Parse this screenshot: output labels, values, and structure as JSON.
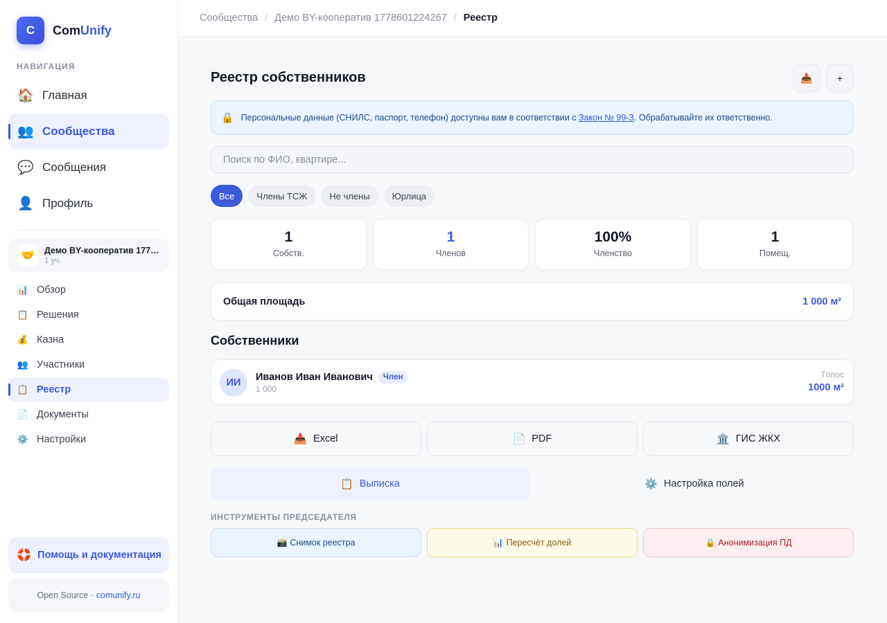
{
  "brand": {
    "badge": "C",
    "name_part1": "Com",
    "name_part2": "Unify"
  },
  "nav": {
    "caption": "НАВИГАЦИЯ",
    "items": [
      {
        "icon": "home-icon",
        "glyph": "🏠",
        "label": "Главная"
      },
      {
        "icon": "users-icon",
        "glyph": "👥",
        "label": "Сообщества"
      },
      {
        "icon": "chat-icon",
        "glyph": "💬",
        "label": "Сообщения"
      },
      {
        "icon": "user-icon",
        "glyph": "👤",
        "label": "Профиль"
      }
    ]
  },
  "community": {
    "glyph": "🤝",
    "name": "Демо BY-кооператив 1778601224267",
    "sub": "1 уч."
  },
  "subnav": [
    {
      "glyph": "📊",
      "label": "Обзор"
    },
    {
      "glyph": "📋",
      "label": "Решения"
    },
    {
      "glyph": "💰",
      "label": "Казна"
    },
    {
      "glyph": "👥",
      "label": "Участники"
    },
    {
      "glyph": "📋",
      "label": "Реестр"
    },
    {
      "glyph": "📄",
      "label": "Документы"
    },
    {
      "glyph": "⚙️",
      "label": "Настройки"
    }
  ],
  "help": {
    "glyph": "🛟",
    "label": "Помощь и документация"
  },
  "footer": {
    "text": "Open Source ·",
    "link": "comunify.ru"
  },
  "breadcrumb": {
    "item1": "Сообщества",
    "item2": "Демо BY-кооператив 1778601224267",
    "current": "Реестр",
    "sep": "/"
  },
  "page": {
    "title": "Реестр собственников",
    "import_glyph": "📥",
    "add_glyph": "+"
  },
  "notice": {
    "glyph": "🔒",
    "text_before": "Персональные данные (СНИЛС, паспорт, телефон) доступны вам в соответствии с ",
    "link": "Закон № 99-З",
    "text_after": ". Обрабатывайте их ответственно."
  },
  "search": {
    "placeholder": "Поиск по ФИО, квартире..."
  },
  "filters": [
    "Все",
    "Члены ТСЖ",
    "Не члены",
    "Юрлица"
  ],
  "stats": [
    {
      "value": "1",
      "label": "Собств."
    },
    {
      "value": "1",
      "label": "Членов"
    },
    {
      "value": "100%",
      "label": "Членство"
    },
    {
      "value": "1",
      "label": "Помещ."
    }
  ],
  "area": {
    "label": "Общая площадь",
    "value": "1 000 м²"
  },
  "owners": {
    "title": "Собственники",
    "items": [
      {
        "initials": "ИИ",
        "name": "Иванов Иван Иванович",
        "badge": "Член",
        "sub": "1 000",
        "vote_label": "Голос",
        "vote_value": "1000 м²"
      }
    ]
  },
  "exports": [
    {
      "glyph": "📥",
      "label": "Excel"
    },
    {
      "glyph": "📄",
      "label": "PDF"
    },
    {
      "glyph": "🏛️",
      "label": "ГИС ЖКХ"
    }
  ],
  "tabs": [
    {
      "glyph": "📋",
      "label": "Выписка"
    },
    {
      "glyph": "⚙️",
      "label": "Настройка полей"
    }
  ],
  "tools": {
    "caption": "ИНСТРУМЕНТЫ ПРЕДСЕДАТЕЛЯ",
    "items": [
      {
        "glyph": "📸",
        "label": "Снимок реестра"
      },
      {
        "glyph": "📊",
        "label": "Пересчёт долей"
      },
      {
        "glyph": "🔒",
        "label": "Анонимизация ПД"
      }
    ]
  },
  "colors": {
    "accent": "#3b5bdb",
    "info_bg": "#eaf3fe",
    "warn_bg": "#fffbe9",
    "danger_bg": "#fdeff1"
  }
}
